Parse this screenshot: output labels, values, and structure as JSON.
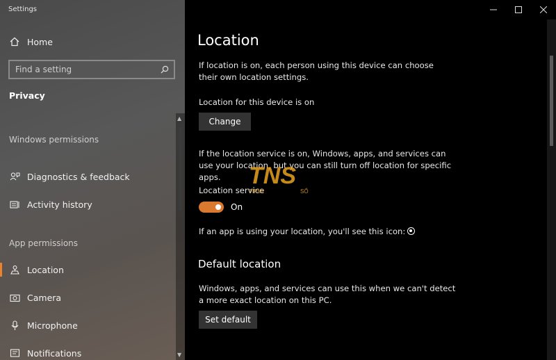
{
  "app_title": "Settings",
  "sidebar": {
    "home_label": "Home",
    "search_placeholder": "Find a setting",
    "section": "Privacy",
    "groups": {
      "windows_permissions": "Windows permissions",
      "app_permissions": "App permissions"
    },
    "items": [
      {
        "label": "Diagnostics & feedback",
        "icon": "diagnostics-icon"
      },
      {
        "label": "Activity history",
        "icon": "activity-history-icon"
      },
      {
        "label": "Location",
        "icon": "location-icon",
        "selected": true
      },
      {
        "label": "Camera",
        "icon": "camera-icon"
      },
      {
        "label": "Microphone",
        "icon": "microphone-icon"
      },
      {
        "label": "Notifications",
        "icon": "notifications-icon"
      }
    ]
  },
  "window_controls": [
    "minimize",
    "maximize",
    "close"
  ],
  "main": {
    "title": "Location",
    "intro": "If location is on, each person using this device can choose their own location settings.",
    "device_status": "Location for this device is on",
    "change_button": "Change",
    "service_info": "If the location service is on, Windows, apps, and services can use your location, but you can still turn off location for specific apps.",
    "service_label": "Location service",
    "toggle_state": "On",
    "icon_info": "If an app is using your location, you'll see this icon:",
    "default_title": "Default location",
    "default_info": "Windows, apps, and services can use this when we can't detect a more exact location on this PC.",
    "set_default_button": "Set default"
  },
  "watermark": {
    "brand": "TNS",
    "sub_left": "TIPMI",
    "sub_right": "SỐ"
  },
  "colors": {
    "accent": "#e8842e",
    "toggle_on": "#d9782f",
    "button_bg": "#333333"
  }
}
